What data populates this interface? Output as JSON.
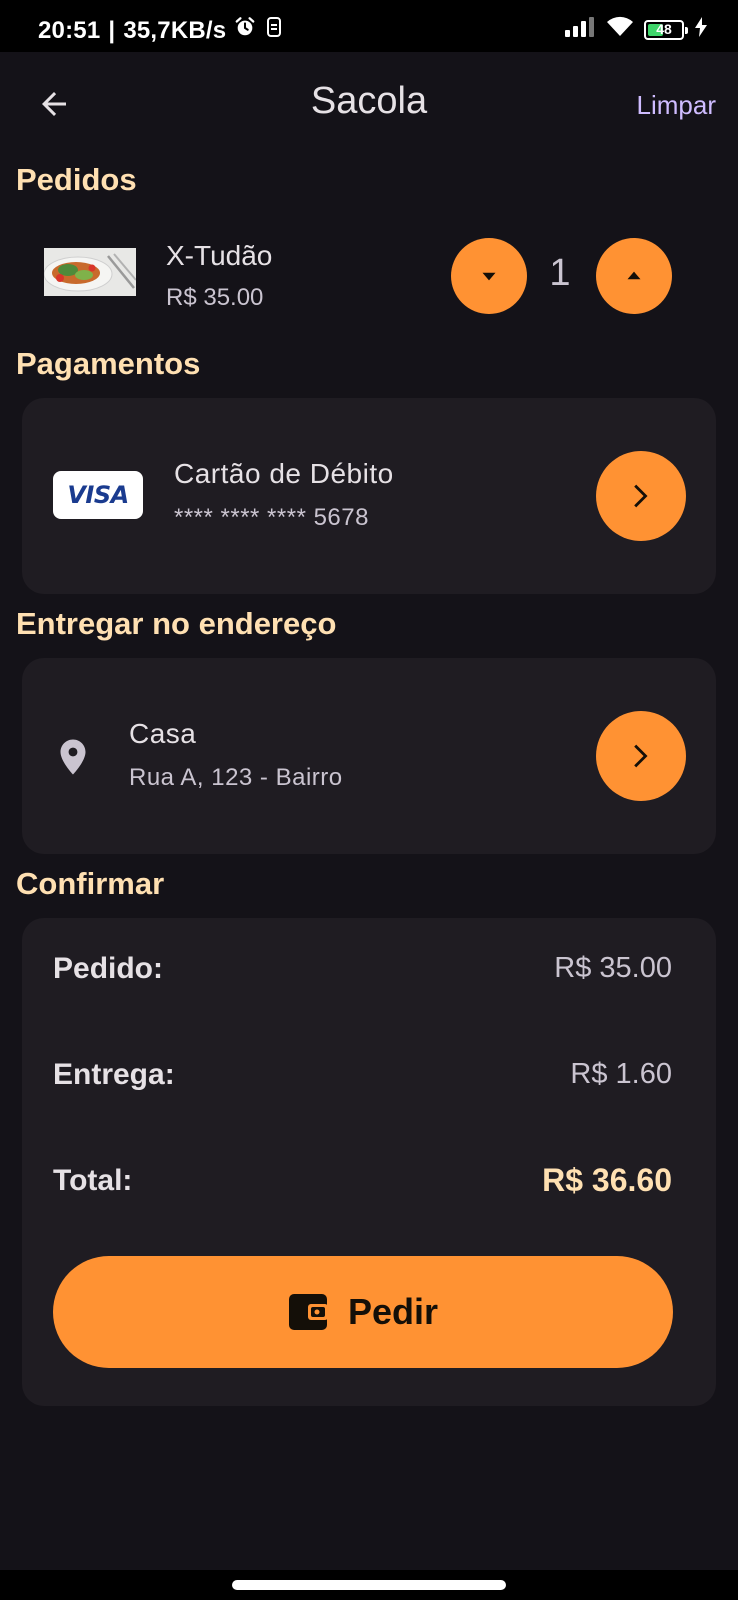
{
  "status_bar": {
    "time": "20:51",
    "separator": "|",
    "network_speed": "35,7KB/s",
    "battery_level": "48",
    "battery_fraction": 0.48,
    "icons": [
      "alarm-icon",
      "sync-icon",
      "signal-icon",
      "wifi-icon",
      "battery-icon",
      "charging-icon"
    ]
  },
  "app_bar": {
    "title": "Sacola",
    "clear_label": "Limpar",
    "back_icon": "arrow-back-icon"
  },
  "sections": {
    "orders": "Pedidos",
    "payments": "Pagamentos",
    "delivery": "Entregar no endereço",
    "confirm": "Confirmar"
  },
  "order_item": {
    "name": "X-Tudão",
    "price": "R$ 35.00",
    "quantity": "1"
  },
  "payment": {
    "brand": "VISA",
    "method": "Cartão de Débito",
    "card_number": "**** **** **** 5678"
  },
  "address": {
    "label": "Casa",
    "line": "Rua A, 123 - Bairro"
  },
  "summary": {
    "order_label": "Pedido:",
    "order_value": "R$ 35.00",
    "delivery_label": "Entrega:",
    "delivery_value": "R$ 1.60",
    "total_label": "Total:",
    "total_value": "R$ 36.60"
  },
  "order_button": {
    "label": "Pedir",
    "icon": "wallet-icon"
  },
  "colors": {
    "background": "#141218",
    "card": "#1f1c22",
    "accent": "#ff9233",
    "heading": "#ffe0b2",
    "link": "#cfbcff"
  }
}
